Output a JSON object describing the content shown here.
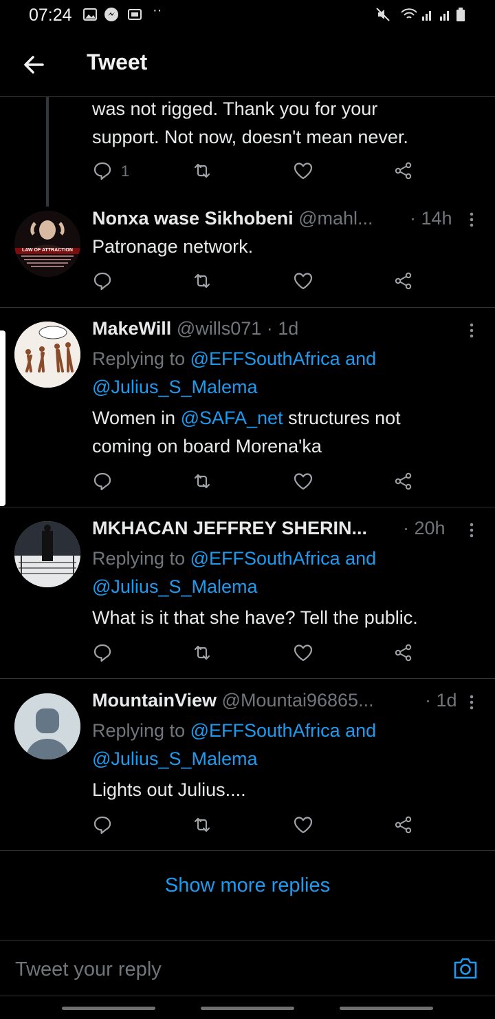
{
  "status_bar": {
    "time": "07:24"
  },
  "header": {
    "title": "Tweet"
  },
  "tweets": [
    {
      "text_lines": [
        "was not rigged. Thank you for your",
        "support. Not now, doesn't mean never."
      ],
      "reply_count": "1"
    },
    {
      "name": "Nonxa wase Sikhobeni",
      "handle": "@mahl...",
      "time": "· 14h",
      "text": "Patronage network.",
      "avatar_caption": "LAW OF ATTRACTION"
    },
    {
      "name": "MakeWill",
      "handle": "@wills071 · 1d",
      "replying_prefix": "Replying to",
      "replying_to_1": "@EFFSouthAfrica and",
      "replying_to_2": "@Julius_S_Malema",
      "text_before": "Women in ",
      "mention": "@SAFA_net",
      "text_after": " structures not",
      "text_line2": "coming on board Morena'ka"
    },
    {
      "name": "MKHACAN JEFFREY SHERIN...",
      "time": "· 20h",
      "replying_prefix": "Replying to",
      "replying_to_1": "@EFFSouthAfrica and",
      "replying_to_2": "@Julius_S_Malema",
      "text": "What is it that she have? Tell the public."
    },
    {
      "name": "MountainView",
      "handle": "@Mountai96865...",
      "time": "· 1d",
      "replying_prefix": "Replying to",
      "replying_to_1": "@EFFSouthAfrica and",
      "replying_to_2": "@Julius_S_Malema",
      "text": "Lights out Julius...."
    }
  ],
  "show_more": "Show more replies",
  "reply_bar": {
    "placeholder": "Tweet your reply"
  },
  "icons": [
    "back-arrow-icon",
    "reply-icon",
    "retweet-icon",
    "like-icon",
    "share-icon",
    "more-icon",
    "camera-icon"
  ],
  "colors": {
    "accent": "#1d9bf0",
    "muted": "#71767b",
    "background": "#000000"
  }
}
